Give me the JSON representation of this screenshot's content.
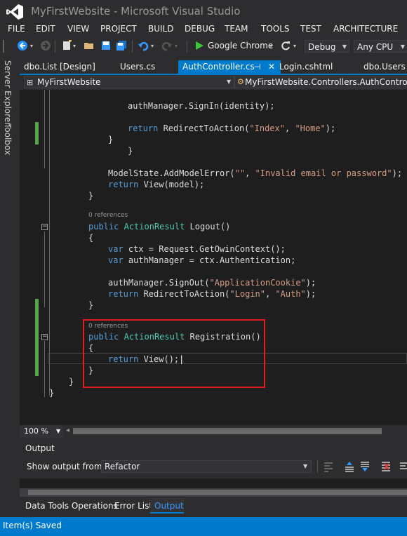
{
  "window": {
    "title": "MyFirstWebsite - Microsoft Visual Studio"
  },
  "menu": [
    "FILE",
    "EDIT",
    "VIEW",
    "PROJECT",
    "BUILD",
    "DEBUG",
    "TEAM",
    "TOOLS",
    "TEST",
    "ARCHITECTURE"
  ],
  "toolbar": {
    "run_label": "Google Chrome",
    "configuration": "Debug",
    "platform": "Any CPU"
  },
  "side_panel": {
    "server_explorer": "Server Explorer",
    "toolbox": "Toolbox"
  },
  "tabs": [
    {
      "label": "dbo.List [Design]",
      "active": false
    },
    {
      "label": "Users.cs",
      "active": false
    },
    {
      "label": "AuthController.cs",
      "active": true
    },
    {
      "label": "Login.cshtml",
      "active": false
    },
    {
      "label": "dbo.Users [D",
      "active": false
    }
  ],
  "navbar": {
    "project": "MyFirstWebsite",
    "class": "MyFirstWebsite.Controllers.AuthController"
  },
  "code": {
    "l1": "authManager.SignIn(identity);",
    "l2_kw": "return",
    "l2_a": " RedirectToAction(",
    "l2_s1": "\"Index\"",
    "l2_b": ", ",
    "l2_s2": "\"Home\"",
    "l2_c": ");",
    "l3": "}",
    "l4": "}",
    "l5_a": "ModelState.AddModelError(",
    "l5_s1": "\"\"",
    "l5_b": ", ",
    "l5_s2": "\"Invalid email or password\"",
    "l5_c": ");",
    "l6_kw": "return",
    "l6_a": " View(model);",
    "l7": "}",
    "refs1": "0 references",
    "l8_kw": "public",
    "l8_ty": "ActionResult",
    "l8_a": " Logout()",
    "l9": "{",
    "l10_kw": "var",
    "l10_a": " ctx = Request.GetOwinContext();",
    "l11_kw": "var",
    "l11_a": " authManager = ctx.Authentication;",
    "l12_a": "authManager.SignOut(",
    "l12_s": "\"ApplicationCookie\"",
    "l12_b": ");",
    "l13_kw": "return",
    "l13_a": " RedirectToAction(",
    "l13_s1": "\"Login\"",
    "l13_b": ", ",
    "l13_s2": "\"Auth\"",
    "l13_c": ");",
    "l14": "}",
    "refs2": "0 references",
    "l15_kw": "public",
    "l15_ty": "ActionResult",
    "l15_a": " Registration()",
    "l16": "{",
    "l17_kw": "return",
    "l17_a": " View();",
    "l18": "}",
    "l19": "}",
    "l20": "}"
  },
  "zoom": "100 %",
  "output": {
    "title": "Output",
    "show_label": "Show output from:",
    "source": "Refactor"
  },
  "bottom_tabs": [
    "Data Tools Operations",
    "Error List",
    "Output"
  ],
  "status": "Item(s) Saved",
  "colors": {
    "accent": "#007acc",
    "keyword": "#569cd6",
    "type": "#4ec9b0",
    "string": "#d69d85",
    "highlight_box": "#e02020"
  }
}
